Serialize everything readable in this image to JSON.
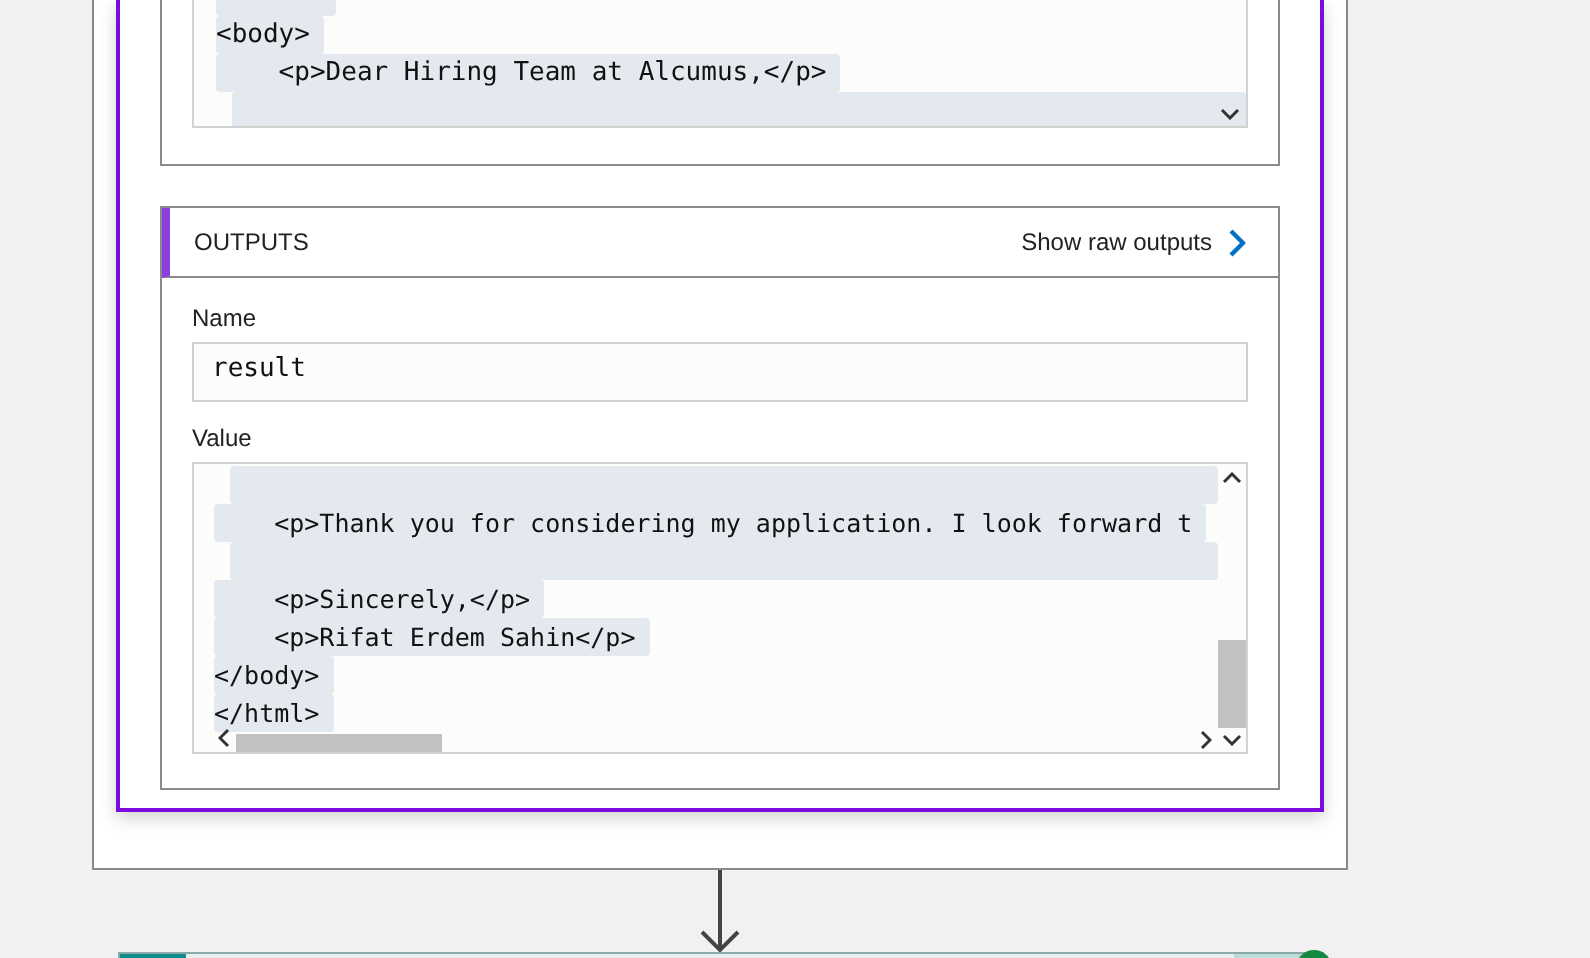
{
  "input_code": {
    "lines": [
      {
        "kind": "blank",
        "selected": true
      },
      {
        "kind": "text",
        "text": "<body>",
        "selected": true
      },
      {
        "kind": "text",
        "text": "    <p>Dear Hiring Team at Alcumus,</p>",
        "selected": true
      },
      {
        "kind": "blank",
        "selected": true
      }
    ]
  },
  "outputs": {
    "title": "OUTPUTS",
    "raw_link": "Show raw outputs",
    "name_label": "Name",
    "name_value": "result",
    "value_label": "Value",
    "value_lines": [
      {
        "kind": "blank",
        "selected": true
      },
      {
        "kind": "text",
        "text": "    <p>Thank you for considering my application. I look forward t",
        "selected": true
      },
      {
        "kind": "blank",
        "selected": true
      },
      {
        "kind": "text",
        "text": "    <p>Sincerely,</p>",
        "selected": true
      },
      {
        "kind": "text",
        "text": "    <p>Rifat Erdem Sahin</p>",
        "selected": true
      },
      {
        "kind": "text",
        "text": "</body>",
        "selected": true
      },
      {
        "kind": "text",
        "text": "</html>",
        "selected": true
      }
    ]
  }
}
